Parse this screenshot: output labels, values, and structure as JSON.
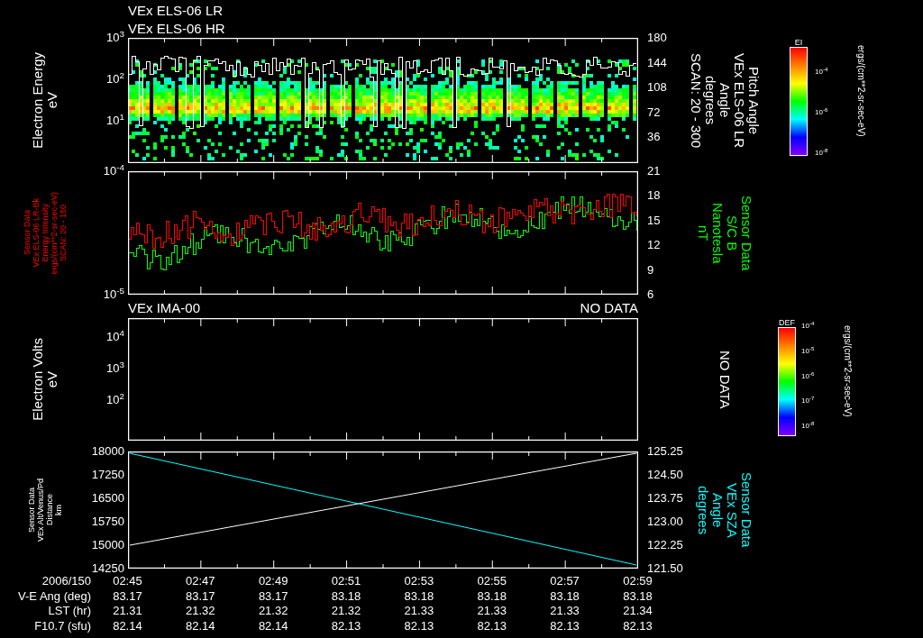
{
  "header": {
    "titles": [
      "VEx ELS-06 LR",
      "VEx ELS-06 HR"
    ]
  },
  "panels": [
    {
      "kind": "spectrogram",
      "left_label": {
        "lines": [
          "Electron Energy",
          "eV"
        ],
        "color": "#ffffff"
      },
      "left_ticks": [
        "10$^{3}$",
        "10$^{2}$",
        "10$^{1}$"
      ],
      "right_ticks": [
        "180",
        "144",
        "108",
        "72",
        "36"
      ],
      "right_label": {
        "lines": [
          "Pitch Angle",
          "VEx ELS-06 LR",
          "Angle",
          "degrees",
          "SCAN: 20 - 300"
        ],
        "color": "#ffffff"
      },
      "colorbar": {
        "title": "EI",
        "ticks": [
          "10$^{-4}$",
          "10$^{-6}$",
          "10$^{-8}$"
        ],
        "units": "ergs/(cm**2-sr-sec-eV)"
      }
    },
    {
      "kind": "lines",
      "left_label": {
        "lines": [
          "Sensor Data",
          "VEx ELS-06 LR-Bk",
          "Energy Intensity",
          "ergs/(cm**2-sr-sec-eV)",
          "SCAN: 20 - 150"
        ],
        "color": "#ff0000"
      },
      "left_ticks": [
        "10$^{-4}$",
        "10$^{-5}$"
      ],
      "right_ticks": [
        "21",
        "18",
        "15",
        "12",
        "9",
        "6"
      ],
      "right_label": {
        "lines": [
          "Sensor Data",
          "S/C B",
          "Nanotesla",
          "nT"
        ],
        "color": "#00ff00"
      }
    },
    {
      "kind": "empty",
      "title": "VEx IMA-00",
      "status": "NO DATA",
      "left_label": {
        "lines": [
          "Electron Volts",
          "eV"
        ],
        "color": "#ffffff"
      },
      "left_ticks": [
        "10$^{4}$",
        "10$^{3}$",
        "10$^{2}$"
      ],
      "right_label": {
        "lines": [
          "NO DATA"
        ],
        "color": "#ffffff"
      },
      "colorbar": {
        "title": "DEF",
        "ticks": [
          "10$^{-4}$",
          "10$^{-5}$",
          "10$^{-6}$",
          "10$^{-7}$",
          "10$^{-8}$"
        ],
        "units": "ergs/(cm**2-sr-sec-eV)"
      }
    },
    {
      "kind": "crossing",
      "left_label": {
        "lines": [
          "Sensor Data",
          "VEx Alt/Venus/Pd",
          "Distance",
          "km"
        ],
        "color": "#ffffff"
      },
      "left_ticks": [
        "18000",
        "17250",
        "16500",
        "15750",
        "15000",
        "14250"
      ],
      "right_ticks": [
        "125.25",
        "124.50",
        "123.75",
        "123.00",
        "122.25",
        "121.50"
      ],
      "right_label": {
        "lines": [
          "Sensor Data",
          "VEx SZA",
          "Angle",
          "degrees"
        ],
        "color": "#00ffff"
      }
    }
  ],
  "ephemeris": {
    "rows": [
      {
        "label": "2006/150",
        "values": [
          "02:45",
          "02:47",
          "02:49",
          "02:51",
          "02:53",
          "02:55",
          "02:57",
          "02:59"
        ]
      },
      {
        "label": "V-E Ang (deg)",
        "values": [
          "83.17",
          "83.17",
          "83.17",
          "83.18",
          "83.18",
          "83.18",
          "83.18",
          "83.18"
        ]
      },
      {
        "label": "LST (hr)",
        "values": [
          "21.31",
          "21.32",
          "21.32",
          "21.32",
          "21.33",
          "21.33",
          "21.33",
          "21.34"
        ]
      },
      {
        "label": "F10.7 (sfu)",
        "values": [
          "82.14",
          "82.14",
          "82.14",
          "82.13",
          "82.13",
          "82.13",
          "82.13",
          "82.13"
        ]
      }
    ]
  }
}
